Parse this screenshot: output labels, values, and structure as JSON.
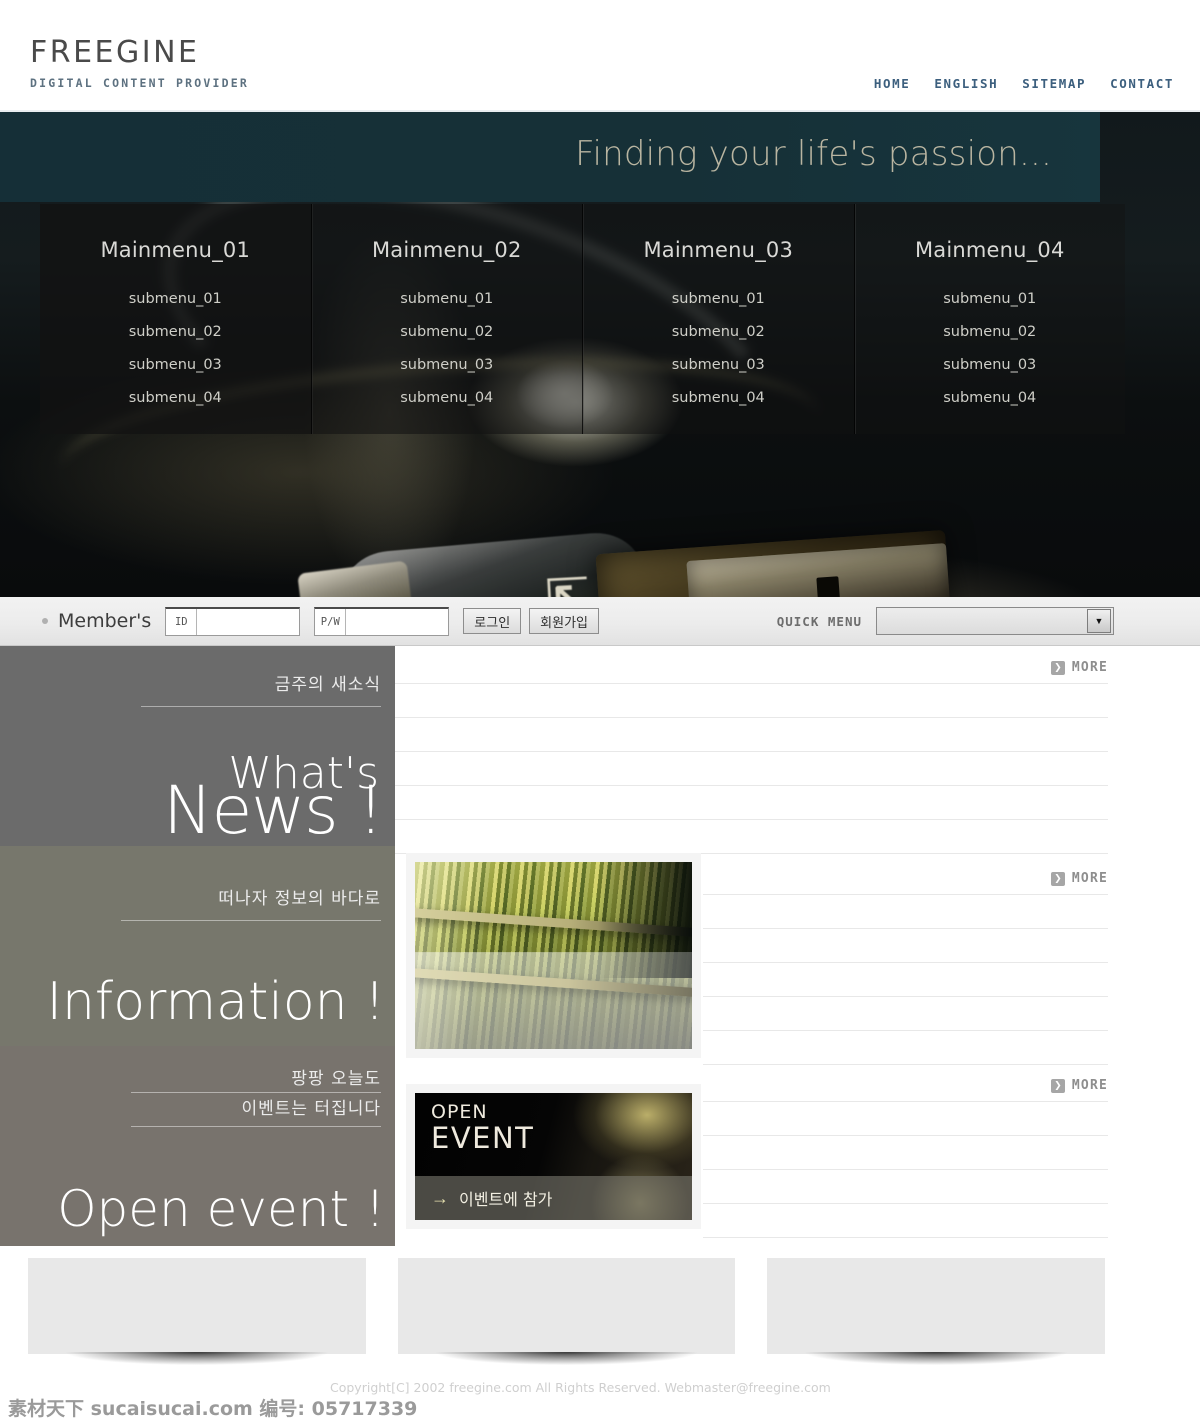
{
  "header": {
    "logo_main": "FREEGINE",
    "logo_sub": "DIGITAL CONTENT PROVIDER",
    "nav": [
      {
        "label": "HOME"
      },
      {
        "label": "ENGLISH"
      },
      {
        "label": "SITEMAP"
      },
      {
        "label": "CONTACT"
      }
    ]
  },
  "hero": {
    "tagline": "Finding your life's passion...",
    "menus": [
      {
        "title": "Mainmenu_01",
        "items": [
          "submenu_01",
          "submenu_02",
          "submenu_03",
          "submenu_04"
        ]
      },
      {
        "title": "Mainmenu_02",
        "items": [
          "submenu_01",
          "submenu_02",
          "submenu_03",
          "submenu_04"
        ]
      },
      {
        "title": "Mainmenu_03",
        "items": [
          "submenu_01",
          "submenu_02",
          "submenu_03",
          "submenu_04"
        ]
      },
      {
        "title": "Mainmenu_04",
        "items": [
          "submenu_01",
          "submenu_02",
          "submenu_03",
          "submenu_04"
        ]
      }
    ]
  },
  "member_bar": {
    "label": "Member's",
    "id_tag": "ID",
    "id_value": "",
    "id_placeholder": "",
    "pw_tag": "P/W",
    "pw_value": "",
    "pw_placeholder": "",
    "login_button": "로그인",
    "signup_button": "회원가입",
    "quick_menu_label": "QUICK MENU",
    "quick_menu_selected": "",
    "quick_menu_arrow": "▼"
  },
  "sections": [
    {
      "korean": "금주의 새소식",
      "english_top": "What's",
      "english_bottom": "News !",
      "more_label": "MORE",
      "more_icon": "❯",
      "row_count": 5
    },
    {
      "korean": "떠나자 정보의 바다로",
      "english_top": "",
      "english_bottom": "Information !",
      "more_label": "MORE",
      "more_icon": "❯",
      "row_count": 5
    },
    {
      "korean_line1": "팡팡 오늘도",
      "korean_line2": "이벤트는 터집니다",
      "english_bottom": "Open event !",
      "more_label": "MORE",
      "more_icon": "❯",
      "row_count": 4
    }
  ],
  "event_card": {
    "title_line1": "OPEN",
    "title_line2": "EVENT",
    "cta_arrow": "→",
    "cta_label": "이벤트에 참가"
  },
  "footer": {
    "copyright": "Copyright[C] 2002 freegine.com  All Rights Reserved. Webmaster@freegine.com",
    "watermark": "素材天下 sucaisucai.com  编号: 05717339"
  },
  "colors": {
    "teal_band": "#163038",
    "panel_news": "#6b6b6b",
    "panel_information": "#77776c",
    "panel_event": "#78736d",
    "nav_link": "#3c5f7e",
    "tagline": "#b9b5a1"
  }
}
